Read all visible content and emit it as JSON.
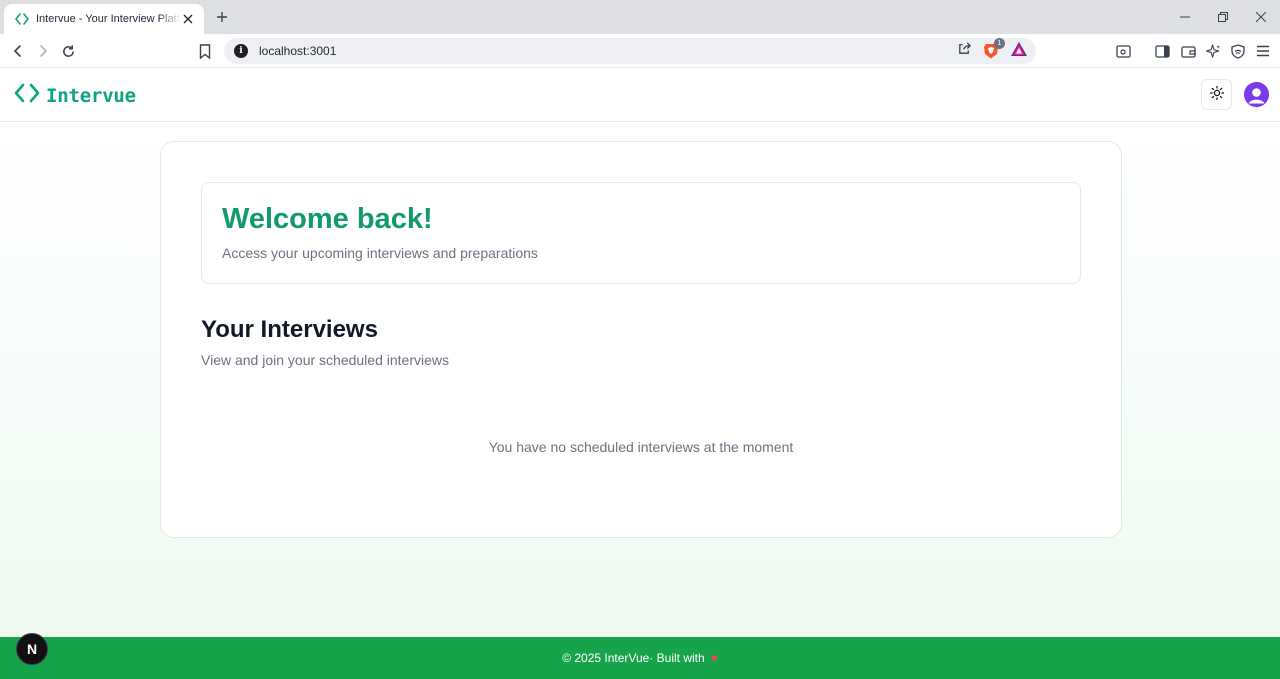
{
  "browser": {
    "tab": {
      "title": "Intervue - Your Interview Platform",
      "favicon": "code-brackets-icon"
    },
    "address": {
      "url": "localhost:3001",
      "info_glyph": "i"
    },
    "brave_shield_count": "1",
    "accent": "#10a37f"
  },
  "header": {
    "logo_text": "Intervue",
    "theme_icon": "sun-icon",
    "avatar_icon": "user-avatar-icon"
  },
  "welcome": {
    "title": "Welcome back!",
    "subtitle": "Access your upcoming interviews and preparations"
  },
  "interviews": {
    "title": "Your Interviews",
    "subtitle": "View and join your scheduled interviews",
    "empty_message": "You have no scheduled interviews at the moment"
  },
  "footer": {
    "text": "© 2025 InterVue· Built with",
    "heart": "♥",
    "background": "#17a34a"
  },
  "dev_badge": {
    "label": "N"
  }
}
